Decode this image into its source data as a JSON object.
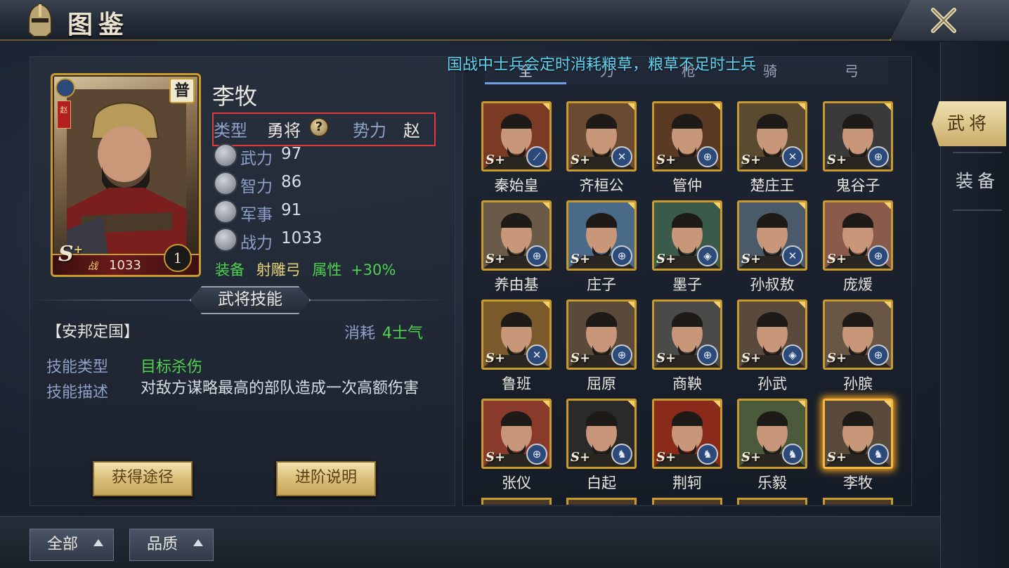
{
  "title": "图鉴",
  "announcement": "国战中士兵会定时消耗粮草，粮草不足时士兵",
  "filter_tabs": [
    {
      "label": "全",
      "active": true
    },
    {
      "label": "刀",
      "active": false
    },
    {
      "label": "枪",
      "active": false
    },
    {
      "label": "骑",
      "active": false
    },
    {
      "label": "弓",
      "active": false
    }
  ],
  "hero": {
    "name": "李牧",
    "card": {
      "grade": "普",
      "flag": "赵",
      "rank": "S",
      "rank_plus": "+",
      "power_label": "战",
      "power": "1033",
      "level": "1"
    },
    "type_label": "类型",
    "type_value": "勇将",
    "help_icon": "?",
    "faction_label": "势力",
    "faction_value": "赵",
    "stats": [
      {
        "label": "武力",
        "value": "97",
        "icon": "sword-icon"
      },
      {
        "label": "智力",
        "value": "86",
        "icon": "scroll-icon"
      },
      {
        "label": "军事",
        "value": "91",
        "icon": "war-icon"
      },
      {
        "label": "战力",
        "value": "1033",
        "icon": "power-icon"
      }
    ],
    "equip_label": "装备",
    "equip_name": "射雕弓",
    "equip_attr_label": "属性",
    "equip_attr_value": "+30%"
  },
  "skill": {
    "section_title": "武将技能",
    "name": "【安邦定国】",
    "cost_label": "消耗",
    "cost_value": "4士气",
    "type_label": "技能类型",
    "type_value": "目标杀伤",
    "desc_label": "技能描述",
    "desc_value": "对敌方谋略最高的部队造成一次高额伤害"
  },
  "buttons": {
    "obtain": "获得途径",
    "advance": "进阶说明"
  },
  "side_tabs": [
    {
      "label": "武将",
      "active": true
    },
    {
      "label": "装备",
      "active": false
    }
  ],
  "bottom_filters": [
    {
      "label": "全部"
    },
    {
      "label": "品质"
    }
  ],
  "heroes": [
    {
      "name": "秦始皇",
      "type": "spear",
      "color": "#7a3a24"
    },
    {
      "name": "齐桓公",
      "type": "blade",
      "color": "#6a4a30"
    },
    {
      "name": "管仲",
      "type": "target",
      "color": "#5a3a22"
    },
    {
      "name": "楚庄王",
      "type": "blade",
      "color": "#5a4a30"
    },
    {
      "name": "鬼谷子",
      "type": "target",
      "color": "#3a3a3a"
    },
    {
      "name": "养由基",
      "type": "target",
      "color": "#6a5a48"
    },
    {
      "name": "庄子",
      "type": "target",
      "color": "#4a6a8a"
    },
    {
      "name": "墨子",
      "type": "shield",
      "color": "#3a5a4a"
    },
    {
      "name": "孙叔敖",
      "type": "blade",
      "color": "#4a5a6a"
    },
    {
      "name": "庞煖",
      "type": "target",
      "color": "#8a5a4a"
    },
    {
      "name": "鲁班",
      "type": "blade",
      "color": "#7a5a2a"
    },
    {
      "name": "屈原",
      "type": "target",
      "color": "#5a4a3a"
    },
    {
      "name": "商鞅",
      "type": "target",
      "color": "#4a4a48"
    },
    {
      "name": "孙武",
      "type": "shield",
      "color": "#5a4a3e"
    },
    {
      "name": "孙膑",
      "type": "target",
      "color": "#6a5644"
    },
    {
      "name": "张仪",
      "type": "target",
      "color": "#8a3a2a"
    },
    {
      "name": "白起",
      "type": "horse",
      "color": "#2a2a2a"
    },
    {
      "name": "荆轲",
      "type": "horse",
      "color": "#8a2a1a"
    },
    {
      "name": "乐毅",
      "type": "horse",
      "color": "#4a5a3a"
    },
    {
      "name": "李牧",
      "type": "horse",
      "color": "#5a4a3a",
      "selected": true
    }
  ]
}
